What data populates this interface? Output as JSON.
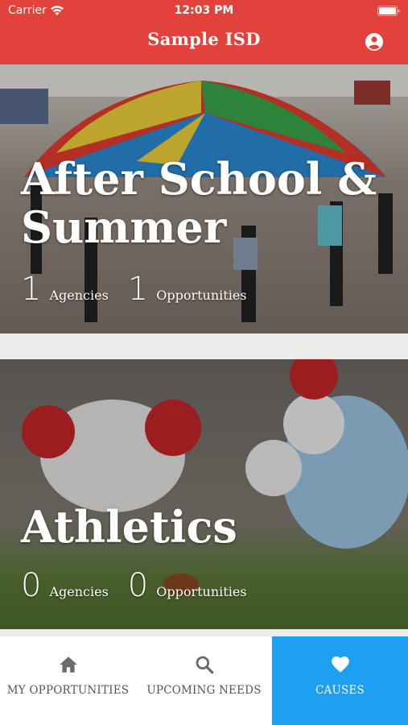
{
  "status_bar": {
    "carrier": "Carrier",
    "time": "12:03 PM"
  },
  "header": {
    "title": "Sample ISD"
  },
  "causes": [
    {
      "title": "After School & Summer",
      "agencies_count": "1",
      "agencies_label": "Agencies",
      "opportunities_count": "1",
      "opportunities_label": "Opportunities"
    },
    {
      "title": "Athletics",
      "agencies_count": "0",
      "agencies_label": "Agencies",
      "opportunities_count": "0",
      "opportunities_label": "Opportunities"
    }
  ],
  "tabs": [
    {
      "label": "MY OPPORTUNITIES",
      "icon": "home-icon"
    },
    {
      "label": "UPCOMING NEEDS",
      "icon": "search-icon"
    },
    {
      "label": "CAUSES",
      "icon": "heart-icon",
      "active": true
    }
  ],
  "colors": {
    "header": "#e2413c",
    "active_tab": "#1da0f2"
  }
}
